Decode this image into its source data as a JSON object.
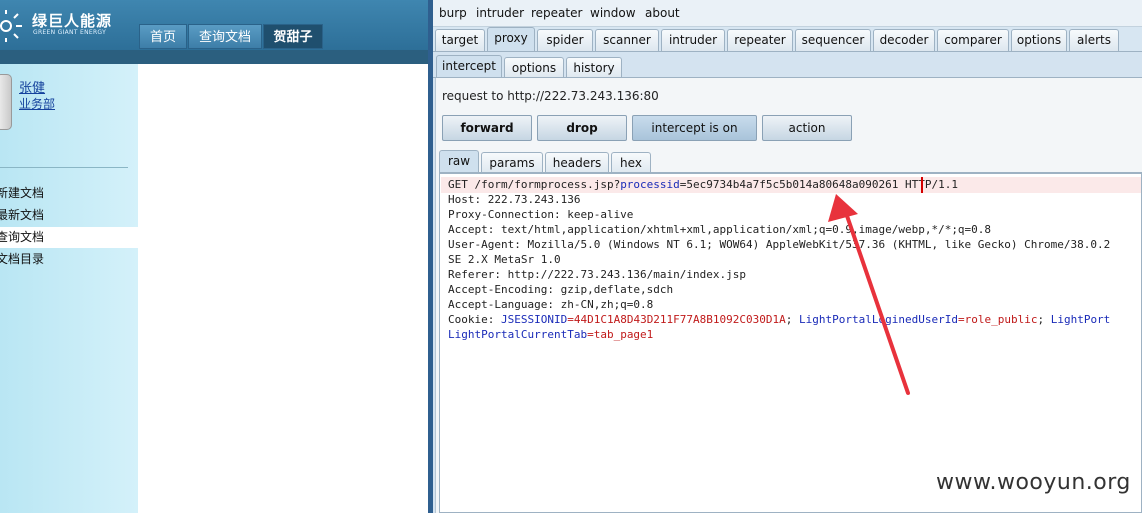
{
  "web": {
    "logo_cn": "绿巨人能源",
    "logo_en": "GREEN GIANT ENERGY",
    "nav": [
      "首页",
      "查询文档",
      "贺甜子"
    ],
    "user_name": "张健",
    "user_dept": "业务部",
    "sidebar": [
      "新建文档",
      "最新文档",
      "查询文档",
      "文档目录"
    ]
  },
  "burp": {
    "menu": [
      "burp",
      "intruder",
      "repeater",
      "window",
      "about"
    ],
    "main_tabs": [
      "target",
      "proxy",
      "spider",
      "scanner",
      "intruder",
      "repeater",
      "sequencer",
      "decoder",
      "comparer",
      "options",
      "alerts"
    ],
    "proxy_tabs": [
      "intercept",
      "options",
      "history"
    ],
    "request_url": "request to http://222.73.243.136:80",
    "buttons": {
      "forward": "forward",
      "drop": "drop",
      "intercept": "intercept is on",
      "action": "action"
    },
    "editor_tabs": [
      "raw",
      "params",
      "headers",
      "hex"
    ],
    "request": {
      "l1_pre": "GET /form/formprocess.jsp?",
      "l1_param": "processid",
      "l1_val": "=5ec9734b4a7f5c5b014a80648a090261",
      "l1_post": " HTTP/1.1",
      "host": "Host: 222.73.243.136",
      "proxy_conn": "Proxy-Connection: keep-alive",
      "accept": "Accept: text/html,application/xhtml+xml,application/xml;q=0.9,image/webp,*/*;q=0.8",
      "user_agent": "User-Agent: Mozilla/5.0 (Windows NT 6.1; WOW64) AppleWebKit/537.36 (KHTML, like Gecko) Chrome/38.0.2",
      "se": "SE 2.X MetaSr 1.0",
      "referer": "Referer: http://222.73.243.136/main/index.jsp",
      "accept_enc": "Accept-Encoding: gzip,deflate,sdch",
      "accept_lang": "Accept-Language: zh-CN,zh;q=0.8",
      "cookie_pre": "Cookie: ",
      "cookie_k1": "JSESSIONID",
      "cookie_v1": "=44D1C1A8D43D211F77A8B1092C030D1A",
      "cookie_sep1": "; ",
      "cookie_k2": "LightPortalLoginedUserId",
      "cookie_v2": "=role_public",
      "cookie_sep2": "; ",
      "cookie_k3": "LightPort",
      "cookie2_k": "LightPortalCurrentTab",
      "cookie2_v": "=tab_page1"
    }
  },
  "watermark": "www.wooyun.org",
  "colors": {
    "arrow": "#e8323c",
    "param": "#1a2bb8",
    "value": "#c01a1a"
  }
}
